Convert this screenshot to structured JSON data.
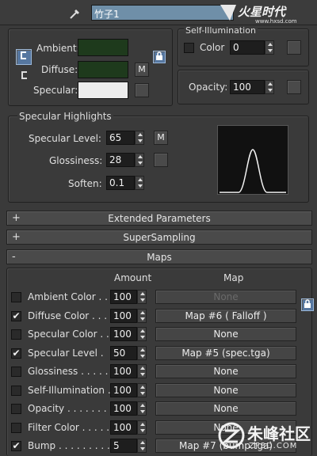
{
  "header": {
    "material_name": "竹子1",
    "watermark_logo": "火星时代",
    "watermark_url": "www.hxsd.com"
  },
  "basic": {
    "ambient_label": "Ambient:",
    "diffuse_label": "Diffuse:",
    "specular_label": "Specular:",
    "m_label": "M",
    "colors": {
      "ambient": "#1e3a1c",
      "diffuse": "#1e3a1c",
      "specular": "#ececec"
    }
  },
  "self_illum": {
    "title": "Self-Illumination",
    "color_label": "Color",
    "value": "0"
  },
  "opacity": {
    "label": "Opacity:",
    "value": "100"
  },
  "specular_highlights": {
    "title": "Specular Highlights",
    "level_label": "Specular Level:",
    "level_value": "65",
    "gloss_label": "Glossiness:",
    "gloss_value": "28",
    "soften_label": "Soften:",
    "soften_value": "0.1",
    "m_label": "M"
  },
  "rollouts": {
    "extended": {
      "sign": "+",
      "title": "Extended Parameters"
    },
    "supersampling": {
      "sign": "+",
      "title": "SuperSampling"
    },
    "maps": {
      "sign": "-",
      "title": "Maps"
    }
  },
  "maps": {
    "amount_header": "Amount",
    "map_header": "Map",
    "rows": [
      {
        "name": "Ambient Color . . .",
        "checked": false,
        "amount": "100",
        "map": "None",
        "disabled": true
      },
      {
        "name": "Diffuse Color . . .",
        "checked": true,
        "amount": "100",
        "map": "Map #6  ( Falloff )",
        "disabled": false
      },
      {
        "name": "Specular Color . .",
        "checked": false,
        "amount": "100",
        "map": "None",
        "disabled": false
      },
      {
        "name": "Specular Level  .",
        "checked": true,
        "amount": "50",
        "map": "Map #5 (spec.tga)",
        "disabled": false
      },
      {
        "name": "Glossiness  . . . . .",
        "checked": false,
        "amount": "100",
        "map": "None",
        "disabled": false
      },
      {
        "name": "Self-Illumination .",
        "checked": false,
        "amount": "100",
        "map": "None",
        "disabled": false
      },
      {
        "name": "Opacity . . . . . . . .",
        "checked": false,
        "amount": "100",
        "map": "None",
        "disabled": false
      },
      {
        "name": "Filter Color . . . . .",
        "checked": false,
        "amount": "100",
        "map": "None",
        "disabled": false
      },
      {
        "name": "Bump  . . . . . . . . .",
        "checked": true,
        "amount": "5",
        "map": "Map #7 (bump.tga)",
        "disabled": false
      }
    ]
  },
  "bottom_watermark": {
    "text": "朱峰社区",
    "url": "ZF3D.COM"
  }
}
